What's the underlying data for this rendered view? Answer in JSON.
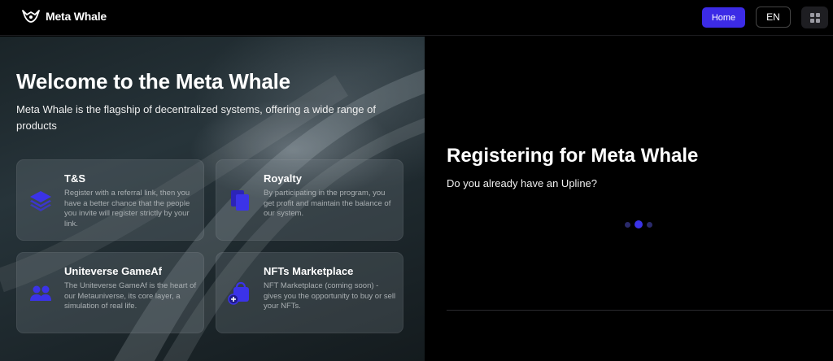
{
  "header": {
    "brand": "Meta Whale",
    "home_label": "Home",
    "lang_label": "EN",
    "logo_icon": "whale-logo-icon",
    "grid_icon": "grid-icon"
  },
  "hero": {
    "title": "Welcome to the Meta Whale",
    "subtitle": "Meta Whale is the flagship of decentralized systems, offering a wide range of products"
  },
  "cards": [
    {
      "title": "T&S",
      "desc": "Register with a referral link, then you have a better chance that the people you invite will register strictly by your link.",
      "icon": "layers-icon"
    },
    {
      "title": "Royalty",
      "desc": "By participating in the program, you get profit and maintain the balance of our system.",
      "icon": "copy-icon"
    },
    {
      "title": "Uniteverse GameAf",
      "desc": "The Uniteverse GameAf is the heart of our Metauniverse, its core layer, a simulation of real life.",
      "icon": "users-icon"
    },
    {
      "title": "NFTs Marketplace",
      "desc": "NFT Marketplace (coming soon) - gives you the opportunity to buy or sell your NFTs.",
      "icon": "bag-plus-icon"
    }
  ],
  "register": {
    "title": "Registering for Meta Whale",
    "question": "Do you already have an Upline?"
  },
  "colors": {
    "accent": "#3c2be6",
    "background": "#000000",
    "card_text": "#aab0b3"
  }
}
